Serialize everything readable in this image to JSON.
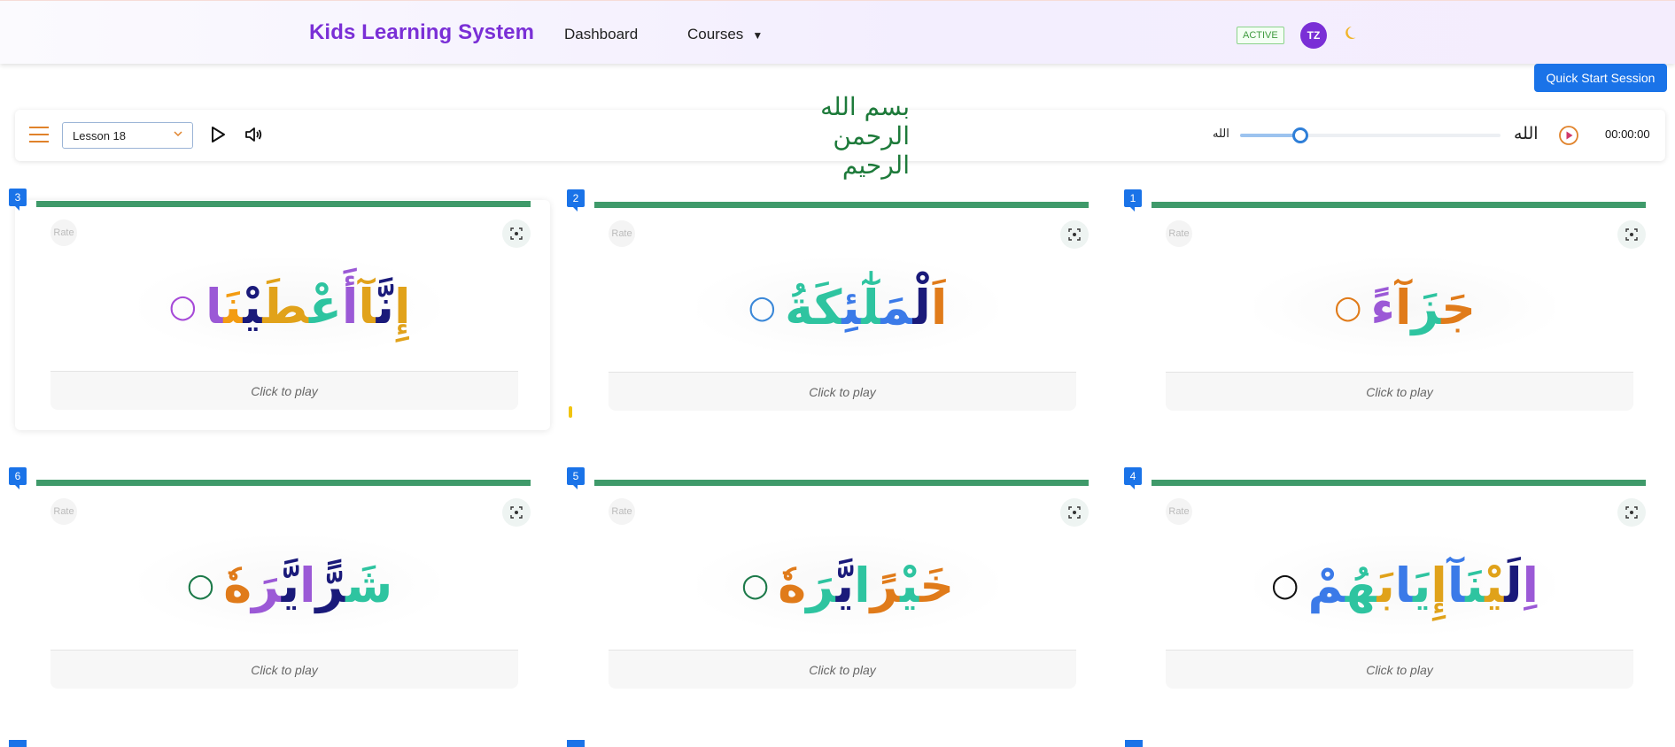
{
  "header": {
    "brand": "Kids Learning System",
    "nav": {
      "dashboard": "Dashboard",
      "courses": "Courses",
      "courses_caret": "▼"
    },
    "status_badge": "ACTIVE",
    "avatar_initials": "TZ",
    "theme_icon": "moon-icon"
  },
  "quick_start_label": "Quick Start Session",
  "toolbar": {
    "lesson_value": "Lesson 18",
    "calligraphy_text": "بسم الله الرحمن الرحيم",
    "allah_small": "الله",
    "allah_large": "الله",
    "slider_value": 0.23,
    "timer": "00:00:00"
  },
  "cards": [
    {
      "number": "3",
      "rate": "Rate",
      "word": "إِنَّآأَعْطَيْنَا",
      "colors": [
        "#e1a21a",
        "#9b59d6",
        "#1a1a7a",
        "#2ec4a0",
        "#f39c12"
      ],
      "ring_color": "#a64ad8",
      "play": "Click to play"
    },
    {
      "number": "2",
      "rate": "Rate",
      "word": "اَلْمَلٰٓئِكَةُ",
      "colors": [
        "#e07b1a",
        "#2ec4a0",
        "#1a1a7a",
        "#2ec4a0",
        "#3b7ae8"
      ],
      "ring_color": "#3b88d8",
      "play": "Click to play"
    },
    {
      "number": "1",
      "rate": "Rate",
      "word": "جَزَآءً",
      "colors": [
        "#e07b1a",
        "#9b59d6",
        "#2ec4a0",
        "#e0b62a"
      ],
      "ring_color": "#e07b1a",
      "play": "Click to play"
    },
    {
      "number": "6",
      "rate": "Rate",
      "word": "شَرًّايَّرَهٗ",
      "colors": [
        "#2ec4a0",
        "#9b59d6",
        "#1a1a7a",
        "#e07b1a"
      ],
      "ring_color": "#1d7a4a",
      "play": "Click to play"
    },
    {
      "number": "5",
      "rate": "Rate",
      "word": "خَيْرًايَّرَهٗ",
      "colors": [
        "#e07b1a",
        "#9b59d6",
        "#2ec4a0",
        "#1a1a7a"
      ],
      "ring_color": "#1d7a4a",
      "play": "Click to play"
    },
    {
      "number": "4",
      "rate": "Rate",
      "word": "اِلَيْنَآإِيَابَهُمْ",
      "colors": [
        "#9b59d6",
        "#2ec4a0",
        "#1a1a7a",
        "#3b7ae8",
        "#e0a21a"
      ],
      "ring_color": "#111111",
      "play": "Click to play"
    }
  ]
}
